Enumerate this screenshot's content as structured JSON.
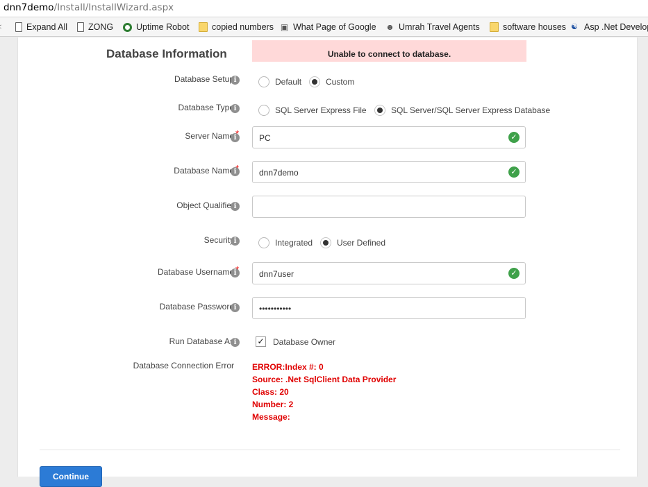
{
  "browser": {
    "url_host": "dnn7demo",
    "url_path": "/Install/InstallWizard.aspx",
    "bookmarks": [
      {
        "label": "Expand All",
        "icon": "page-icon"
      },
      {
        "label": "ZONG",
        "icon": "page-icon"
      },
      {
        "label": "Uptime Robot",
        "icon": "uptime-robot-icon"
      },
      {
        "label": "copied numbers",
        "icon": "folder-icon"
      },
      {
        "label": "What Page of Google",
        "icon": "globe-icon"
      },
      {
        "label": "Umrah Travel Agents",
        "icon": "globe-icon"
      },
      {
        "label": "software houses",
        "icon": "folder-icon"
      },
      {
        "label": "Asp .Net Develop",
        "icon": "asp-net-icon"
      }
    ]
  },
  "form": {
    "title": "Database Information",
    "error_banner": "Unable to connect to database.",
    "database_setup": {
      "label": "Database Setup",
      "options": [
        "Default",
        "Custom"
      ],
      "selected": "Custom"
    },
    "database_type": {
      "label": "Database Type",
      "options": [
        "SQL Server Express File",
        "SQL Server/SQL Server Express Database"
      ],
      "selected": "SQL Server/SQL Server Express Database"
    },
    "server_name": {
      "label": "Server Name",
      "value": "PC",
      "required": true
    },
    "database_name": {
      "label": "Database Name",
      "value": "dnn7demo",
      "required": true
    },
    "object_qualifier": {
      "label": "Object Qualifier",
      "value": ""
    },
    "security": {
      "label": "Security",
      "options": [
        "Integrated",
        "User Defined"
      ],
      "selected": "User Defined"
    },
    "database_username": {
      "label": "Database Username",
      "value": "dnn7user",
      "required": true
    },
    "database_password": {
      "label": "Database Password",
      "value": "•••••••••••"
    },
    "run_as": {
      "label": "Run Database As",
      "checkbox_label": "Database Owner",
      "checked": true
    },
    "connection_error": {
      "label": "Database Connection Error",
      "lines": [
        "ERROR:Index #: 0",
        "Source: .Net SqlClient Data Provider",
        "Class: 20",
        "Number: 2",
        "Message:"
      ]
    },
    "continue_label": "Continue"
  },
  "colors": {
    "error_red": "#e00000",
    "banner_bg": "#ffd9d9",
    "button_blue": "#2c7bd6",
    "valid_green": "#3fa14a"
  }
}
